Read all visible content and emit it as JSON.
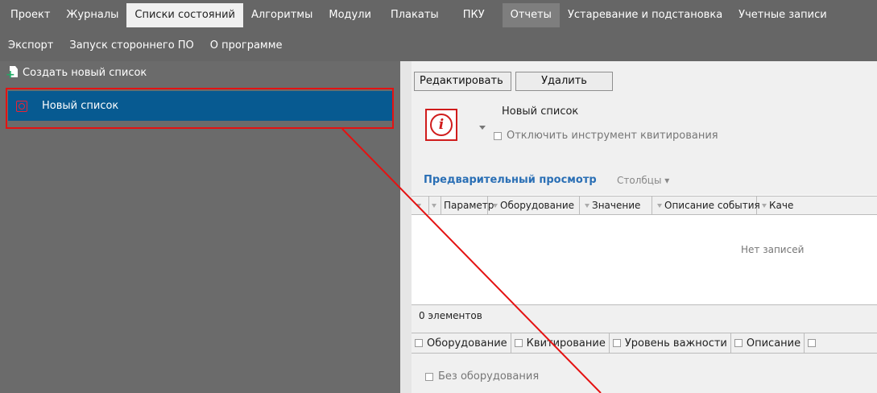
{
  "menu": {
    "row1": [
      {
        "label": "Проект"
      },
      {
        "label": "Журналы"
      },
      {
        "label": "Списки состояний",
        "active": true
      },
      {
        "label": "Алгоритмы"
      },
      {
        "label": "Модули"
      },
      {
        "label": "Плакаты"
      },
      {
        "label": "ПКУ"
      },
      {
        "label": "Отчеты"
      },
      {
        "label": "Устаревание и подстановка"
      },
      {
        "label": "Учетные записи"
      }
    ],
    "row2": [
      {
        "label": "Экспорт"
      },
      {
        "label": "Запуск стороннего ПО"
      },
      {
        "label": "О программе"
      }
    ]
  },
  "left_panel": {
    "create_label": "Создать новый список",
    "items": [
      {
        "label": "Новый список",
        "selected": true
      }
    ]
  },
  "toolbar": {
    "edit_label": "Редактировать",
    "delete_label": "Удалить"
  },
  "details": {
    "name": "Новый список",
    "disable_ack_label": "Отключить инструмент квитирования",
    "icon": "info-icon"
  },
  "preview": {
    "title": "Предварительный просмотр",
    "columns_label": "Столбцы ▾",
    "headers": [
      "Параметр",
      "Оборудование",
      "Значение",
      "Описание события",
      "Каче"
    ],
    "empty_text": "Нет записей",
    "count_text": "0 элементов"
  },
  "filters": {
    "tags": [
      "Оборудование",
      "Квитирование",
      "Уровень важности",
      "Описание"
    ],
    "no_equipment_label": "Без оборудования"
  },
  "colors": {
    "selected": "#075a91",
    "accent_red": "#e41212",
    "link": "#2a6fb5"
  }
}
